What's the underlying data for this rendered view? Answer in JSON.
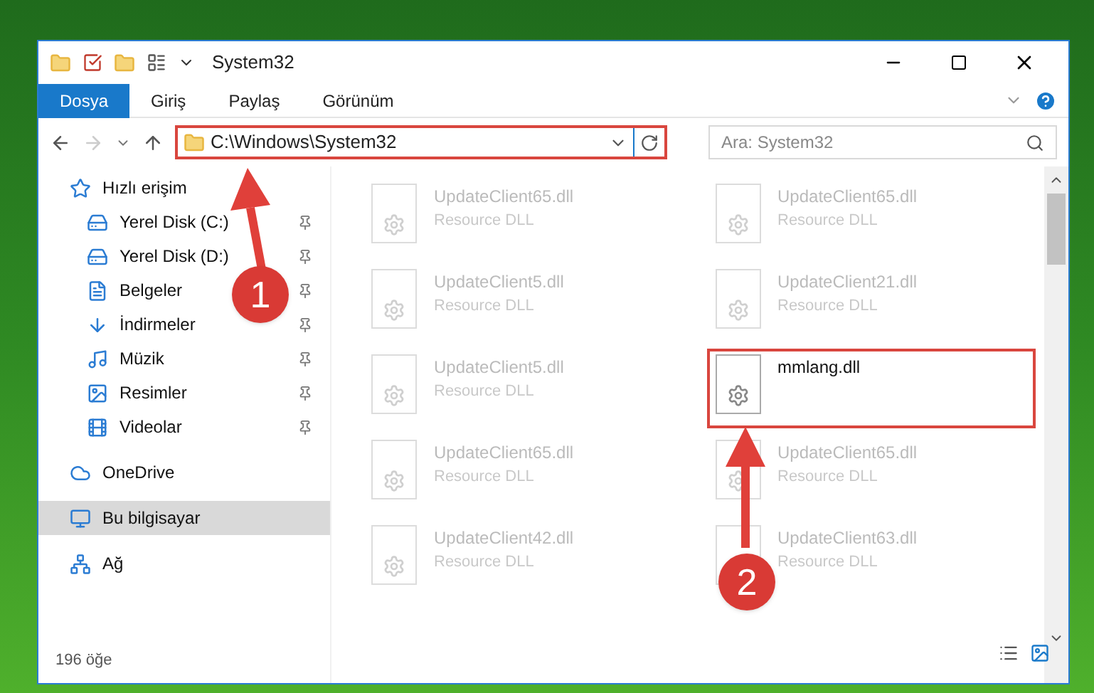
{
  "window": {
    "title": "System32"
  },
  "ribbon_tabs": [
    {
      "label": "Dosya",
      "selected": true
    },
    {
      "label": "Giriş",
      "selected": false
    },
    {
      "label": "Paylaş",
      "selected": false
    },
    {
      "label": "Görünüm",
      "selected": false
    }
  ],
  "address_bar": {
    "path": "C:\\Windows\\System32"
  },
  "search": {
    "placeholder": "Ara: System32"
  },
  "sidebar": {
    "items": [
      {
        "label": "Hızlı erişim",
        "selected": false,
        "children": [
          {
            "label": "Yerel Disk (C:)",
            "selected": false,
            "pinned": true
          },
          {
            "label": "Yerel Disk (D:)",
            "selected": false,
            "pinned": true
          },
          {
            "label": "Belgeler",
            "selected": false,
            "pinned": true
          },
          {
            "label": "İndirmeler",
            "selected": false,
            "pinned": true
          },
          {
            "label": "Müzik",
            "selected": false,
            "pinned": true
          },
          {
            "label": "Resimler",
            "selected": false,
            "pinned": true
          },
          {
            "label": "Videolar",
            "selected": false,
            "pinned": true
          }
        ]
      },
      {
        "label": "OneDrive",
        "selected": false
      },
      {
        "label": "Bu bilgisayar",
        "selected": true
      },
      {
        "label": "Ağ",
        "selected": false
      }
    ]
  },
  "files": [
    {
      "name": "UpdateClient65.dll",
      "type": "Resource DLL",
      "highlighted": false
    },
    {
      "name": "UpdateClient65.dll",
      "type": "Resource DLL",
      "highlighted": false
    },
    {
      "name": "UpdateClient5.dll",
      "type": "Resource DLL",
      "highlighted": false
    },
    {
      "name": "UpdateClient21.dll",
      "type": "Resource DLL",
      "highlighted": false
    },
    {
      "name": "UpdateClient5.dll",
      "type": "Resource DLL",
      "highlighted": false
    },
    {
      "name": "mmlang.dll",
      "highlighted": true
    },
    {
      "name": "UpdateClient65.dll",
      "type": "Resource DLL",
      "highlighted": false
    },
    {
      "name": "UpdateClient65.dll",
      "type": "Resource DLL",
      "highlighted": false
    },
    {
      "name": "UpdateClient42.dll",
      "type": "Resource DLL",
      "highlighted": false
    },
    {
      "name": "UpdateClient63.dll",
      "type": "Resource DLL",
      "highlighted": false
    }
  ],
  "status_bar": {
    "count": "196 öğe"
  },
  "annotations": [
    {
      "number": "1"
    },
    {
      "number": "2"
    }
  ]
}
